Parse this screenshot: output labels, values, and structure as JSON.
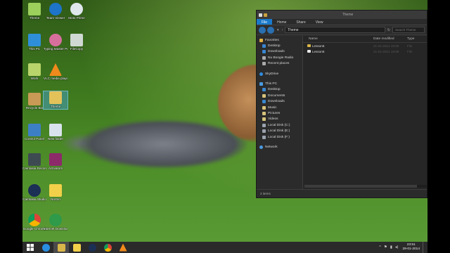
{
  "desktop_icons": [
    {
      "label": "Theme"
    },
    {
      "label": "Team Viewer"
    },
    {
      "label": "Moto Prime"
    },
    {
      "label": "This PC"
    },
    {
      "label": "Typing Master Pro"
    },
    {
      "label": "FileCopy"
    },
    {
      "label": "Work"
    },
    {
      "label": "VLC media player"
    },
    {
      "label": "Recycle Bin"
    },
    {
      "label": "Theme"
    },
    {
      "label": "Control Panel"
    },
    {
      "label": "New folder"
    },
    {
      "label": "Camtasia Recorder"
    },
    {
      "label": "Activators"
    },
    {
      "label": "Camtasia Studio"
    },
    {
      "label": "Norton"
    },
    {
      "label": "Google Chrome"
    },
    {
      "label": "Internet Download"
    }
  ],
  "explorer": {
    "title": "Theme",
    "ribbon_tabs": [
      "File",
      "Home",
      "Share",
      "View"
    ],
    "address": "Theme",
    "search_placeholder": "Search Theme",
    "nav": {
      "favorites": "Favorites",
      "favorites_items": [
        "Desktop",
        "Downloads",
        "Nu Boogie Radio",
        "Recent places"
      ],
      "skydrive": "SkyDrive",
      "thispc": "This PC",
      "thispc_items": [
        "Desktop",
        "Documents",
        "Downloads",
        "Music",
        "Pictures",
        "Videos",
        "Local Disk (C:)",
        "Local Disk (E:)",
        "Local Disk (F:)"
      ],
      "network": "Network"
    },
    "columns": {
      "name": "Name",
      "date": "Date modified",
      "type": "Type"
    },
    "files": [
      {
        "name": "Lesson5",
        "date": "21-01-2014 18:09",
        "type": "File"
      },
      {
        "name": "Lesson5",
        "date": "21-01-2014 18:09",
        "type": "File"
      }
    ],
    "status": "2 items"
  },
  "taskbar": {
    "clock_time": "23:51",
    "clock_date": "29-01-2014",
    "tray": [
      "^",
      "⚑",
      "▮",
      "◂)"
    ]
  },
  "colors": {
    "accent": "#1979ca",
    "window_bg": "#2d2d2d",
    "taskbar_bg": "#2a2a2a"
  }
}
